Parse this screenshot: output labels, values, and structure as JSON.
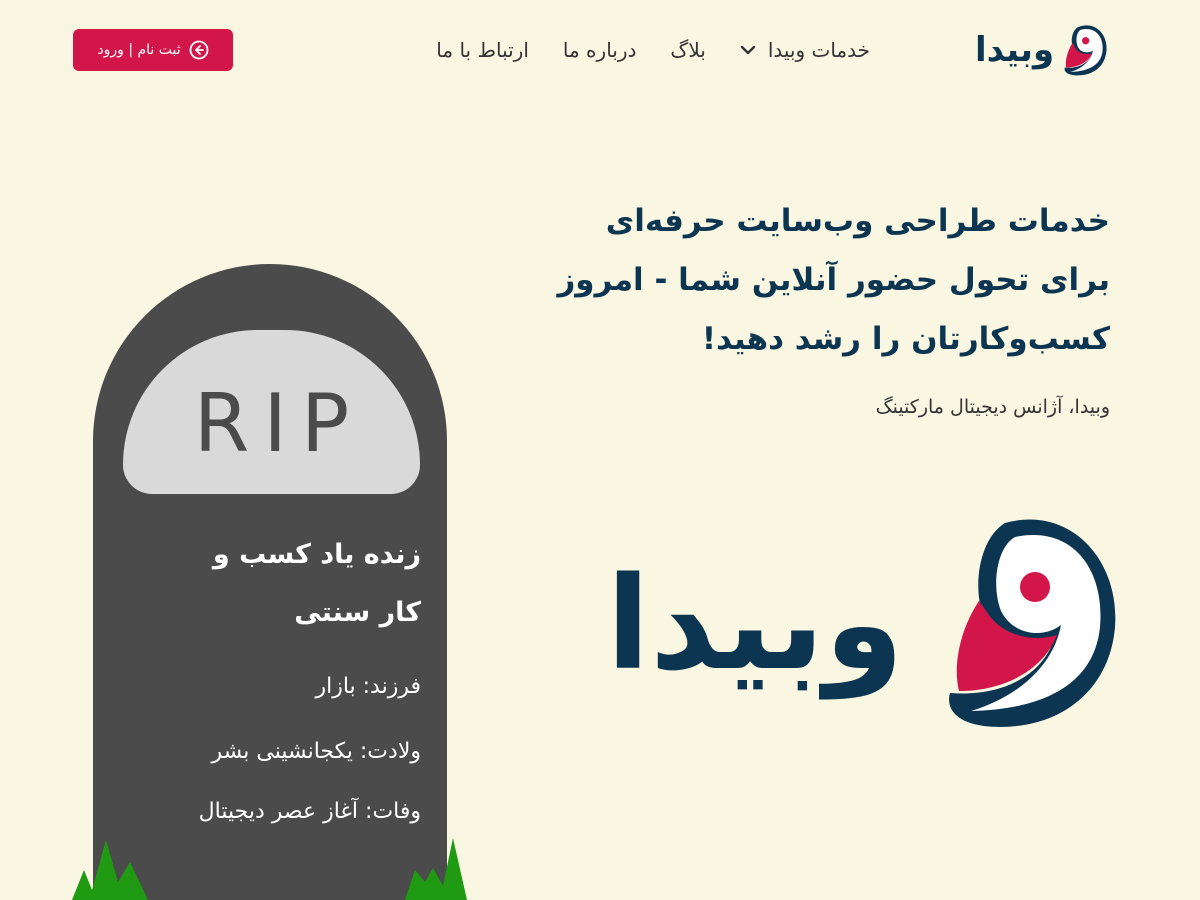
{
  "header": {
    "logo_text": "وبیدا",
    "nav": [
      {
        "label": "خدمات وبیدا",
        "has_dropdown": true
      },
      {
        "label": "بلاگ"
      },
      {
        "label": "درباره ما"
      },
      {
        "label": "ارتباط با ما"
      }
    ],
    "login_button": {
      "label": "ثبت نام | ورود",
      "icon": "login-icon"
    }
  },
  "hero": {
    "title_lines": [
      "خدمات طراحی وب‌سایت حرفه‌ای",
      "برای تحول حضور آنلاین شما - امروز",
      "کسب‌وکارتان را رشد دهید!"
    ],
    "subtitle": "وبیدا، آژانس دیجیتال مارکتینگ",
    "big_logo_text": "وبیدا"
  },
  "tombstone": {
    "plaque_text": "RIP",
    "title_lines": [
      "زنده یاد کسب و",
      "کار سنتی"
    ],
    "child": "فرزند: بازار",
    "birth": "ولادت: یکجانشینی بشر",
    "death": "وفات: آغاز عصر دیجیتال"
  },
  "colors": {
    "background": "#f9f6e2",
    "brand_navy": "#0b3550",
    "brand_red": "#d3164a",
    "tombstone": "#4b4b4b",
    "grass": "#1f9a12"
  }
}
